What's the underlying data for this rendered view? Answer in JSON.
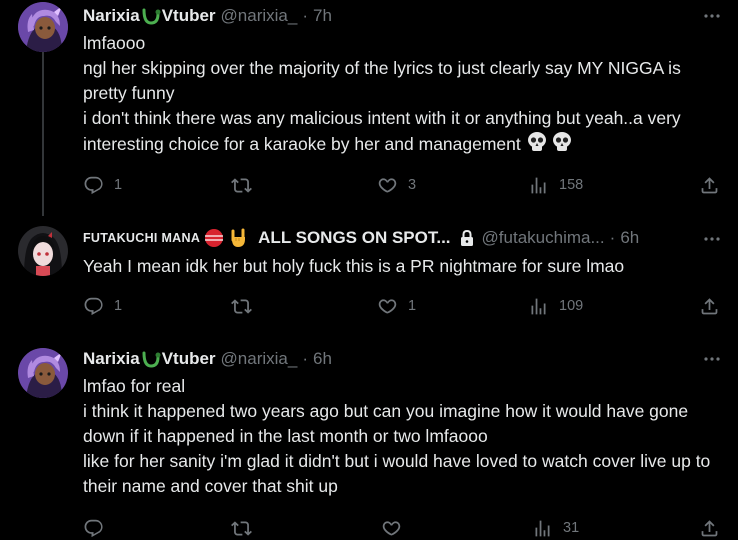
{
  "colors": {
    "background": "#000000",
    "text_primary": "#e7e9ea",
    "text_secondary": "#71767b",
    "thread_line": "#333639"
  },
  "tweets": [
    {
      "display_name": "Narixia",
      "display_name_suffix": "Vtuber",
      "handle": "@narixia_",
      "time": "7h",
      "separator": "·",
      "lines": [
        "lmfaooo",
        "ngl her skipping over the majority of the lyrics to just clearly say MY NIGGA is pretty funny",
        "i don't think there was any malicious intent with it or anything but yeah..a very interesting choice for a karaoke by her and management"
      ],
      "emoji": "💀💀",
      "replies": "1",
      "reposts": "",
      "likes": "3",
      "views": "158"
    },
    {
      "display_name": "FUTAKUCHI MANA",
      "display_name_suffix": "ALL SONGS ON SPOT...",
      "handle": "@futakuchima...",
      "time": "6h",
      "separator": "·",
      "lines": [
        "Yeah I mean idk her but holy fuck this is a PR nightmare for sure lmao"
      ],
      "replies": "1",
      "reposts": "",
      "likes": "1",
      "views": "109"
    },
    {
      "display_name": "Narixia",
      "display_name_suffix": "Vtuber",
      "handle": "@narixia_",
      "time": "6h",
      "separator": "·",
      "lines": [
        "lmfao for real",
        "i think it happened two years ago but can you imagine how it would have gone down if it happened in the last month or two lmfaooo",
        "like for her sanity i'm glad it didn't but i would have loved to watch cover live up to their name and cover that shit up"
      ],
      "replies": "",
      "reposts": "",
      "likes": "",
      "views": "31"
    }
  ]
}
